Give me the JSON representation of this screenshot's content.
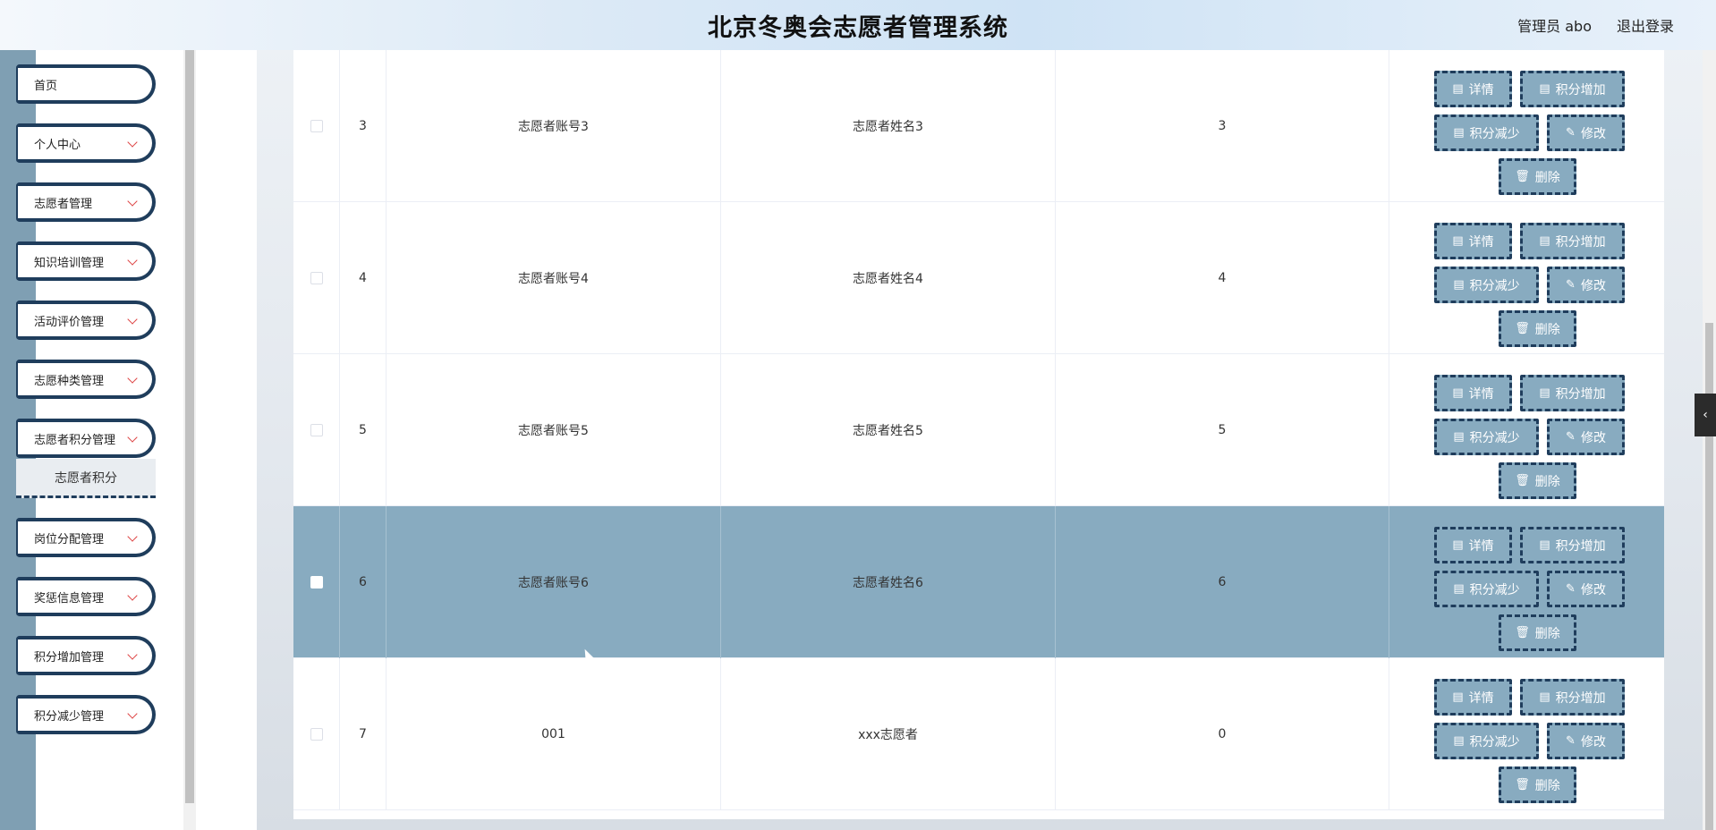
{
  "header": {
    "title": "北京冬奥会志愿者管理系统",
    "user": "管理员 abo",
    "logout": "退出登录"
  },
  "sidebar": {
    "items": [
      {
        "label": "首页"
      },
      {
        "label": "个人中心"
      },
      {
        "label": "志愿者管理"
      },
      {
        "label": "知识培训管理"
      },
      {
        "label": "活动评价管理"
      },
      {
        "label": "志愿种类管理"
      },
      {
        "label": "志愿者积分管理"
      },
      {
        "label": "岗位分配管理"
      },
      {
        "label": "奖惩信息管理"
      },
      {
        "label": "积分增加管理"
      },
      {
        "label": "积分减少管理"
      }
    ],
    "submenu": {
      "label": "志愿者积分"
    }
  },
  "actions": {
    "detail": "详情",
    "add": "积分增加",
    "subtract": "积分减少",
    "edit": "修改",
    "delete": "删除"
  },
  "icons": {
    "detail": "document-icon",
    "edit": "pencil-icon",
    "delete": "trash-icon",
    "toggle": "chevron-left-icon"
  },
  "colors": {
    "accent": "#88abc0",
    "border_dark": "#1f3d5c"
  },
  "rows": [
    {
      "index": "3",
      "account": "志愿者账号3",
      "name": "志愿者姓名3",
      "points": "3",
      "highlighted": false
    },
    {
      "index": "4",
      "account": "志愿者账号4",
      "name": "志愿者姓名4",
      "points": "4",
      "highlighted": false
    },
    {
      "index": "5",
      "account": "志愿者账号5",
      "name": "志愿者姓名5",
      "points": "5",
      "highlighted": false
    },
    {
      "index": "6",
      "account": "志愿者账号6",
      "name": "志愿者姓名6",
      "points": "6",
      "highlighted": true
    },
    {
      "index": "7",
      "account": "001",
      "name": "xxx志愿者",
      "points": "0",
      "highlighted": false
    }
  ]
}
